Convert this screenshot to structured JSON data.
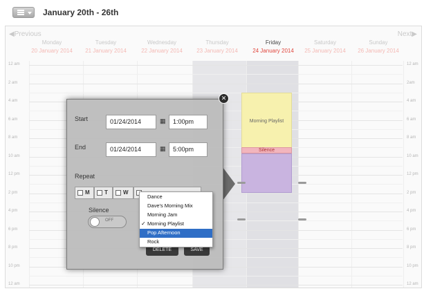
{
  "header": {
    "week_title": "January 20th - 26th"
  },
  "calendar": {
    "prev_label": "Previous",
    "next_label": "Next",
    "days": [
      {
        "name": "Monday",
        "date": "20 January 2014",
        "active": false
      },
      {
        "name": "Tuesday",
        "date": "21 January 2014",
        "active": false
      },
      {
        "name": "Wednesday",
        "date": "22 January 2014",
        "active": false
      },
      {
        "name": "Thursday",
        "date": "23 January 2014",
        "active": false
      },
      {
        "name": "Friday",
        "date": "24 January 2014",
        "active": true
      },
      {
        "name": "Saturday",
        "date": "25 January 2014",
        "active": false
      },
      {
        "name": "Sunday",
        "date": "26 January 2014",
        "active": false
      }
    ],
    "time_labels_left": [
      "12 am",
      "2 am",
      "4 am",
      "6 am",
      "8 am",
      "10 am",
      "12 pm",
      "2 pm",
      "4 pm",
      "6 pm",
      "8 pm",
      "10 pm",
      "12 am"
    ],
    "time_labels_right": [
      "12 am",
      "2am",
      "4 am",
      "6 am",
      "8 am",
      "10 am",
      "12 pm",
      "2 pm",
      "4 pm",
      "6 pm",
      "8 pm",
      "10 pm",
      "12 am"
    ]
  },
  "events": {
    "playlist_label": "Morning Playlist",
    "silence_label": "Silence"
  },
  "popup": {
    "start_label": "Start",
    "start_date": "01/24/2014",
    "start_time": "1:00pm",
    "end_label": "End",
    "end_date": "01/24/2014",
    "end_time": "5:00pm",
    "repeat_label": "Repeat",
    "repeat_days": [
      "M",
      "T",
      "W"
    ],
    "silence_label": "Silence",
    "toggle_label": "OFF",
    "delete_label": "DELETE",
    "save_label": "SAVE"
  },
  "dropdown": {
    "options": [
      {
        "label": "Dance",
        "checked": false,
        "selected": false
      },
      {
        "label": "Dave's Morning Mix",
        "checked": false,
        "selected": false
      },
      {
        "label": "Morning Jam",
        "checked": false,
        "selected": false
      },
      {
        "label": "Morning Playlist",
        "checked": true,
        "selected": false
      },
      {
        "label": "Pop Afternoon",
        "checked": false,
        "selected": true
      },
      {
        "label": "Rock",
        "checked": false,
        "selected": false
      }
    ],
    "check_mark": "✓"
  },
  "colors": {
    "active_date": "#e0463d",
    "playlist": "#f7f1ae",
    "silence": "#f2b5bd",
    "pop_afternoon": "#c9b4e0",
    "dropdown_selected": "#2f6ec6"
  }
}
